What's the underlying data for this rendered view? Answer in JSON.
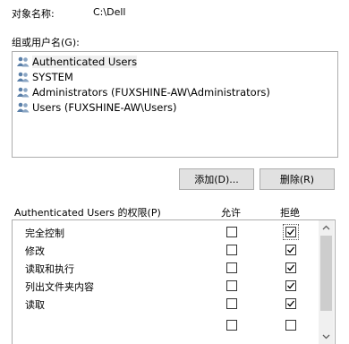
{
  "object": {
    "label": "对象名称:",
    "value": "C:\\Dell"
  },
  "groups": {
    "label": "组或用户名(G):",
    "users": [
      {
        "name": "Authenticated Users"
      },
      {
        "name": "SYSTEM"
      },
      {
        "name": "Administrators (FUXSHINE-AW\\Administrators)"
      },
      {
        "name": "Users (FUXSHINE-AW\\Users)"
      }
    ]
  },
  "buttons": {
    "add": "添加(D)...",
    "remove": "删除(R)"
  },
  "permissions": {
    "title": "Authenticated Users 的权限(P)",
    "allow_header": "允许",
    "deny_header": "拒绝",
    "rows": [
      {
        "name": "完全控制",
        "allow": false,
        "deny": true
      },
      {
        "name": "修改",
        "allow": false,
        "deny": true
      },
      {
        "name": "读取和执行",
        "allow": false,
        "deny": true
      },
      {
        "name": "列出文件夹内容",
        "allow": false,
        "deny": true
      },
      {
        "name": "读取",
        "allow": false,
        "deny": true
      },
      {
        "name": "",
        "allow": false,
        "deny": false
      }
    ]
  },
  "icons": {
    "user": "users-icon",
    "check": "check-icon"
  }
}
